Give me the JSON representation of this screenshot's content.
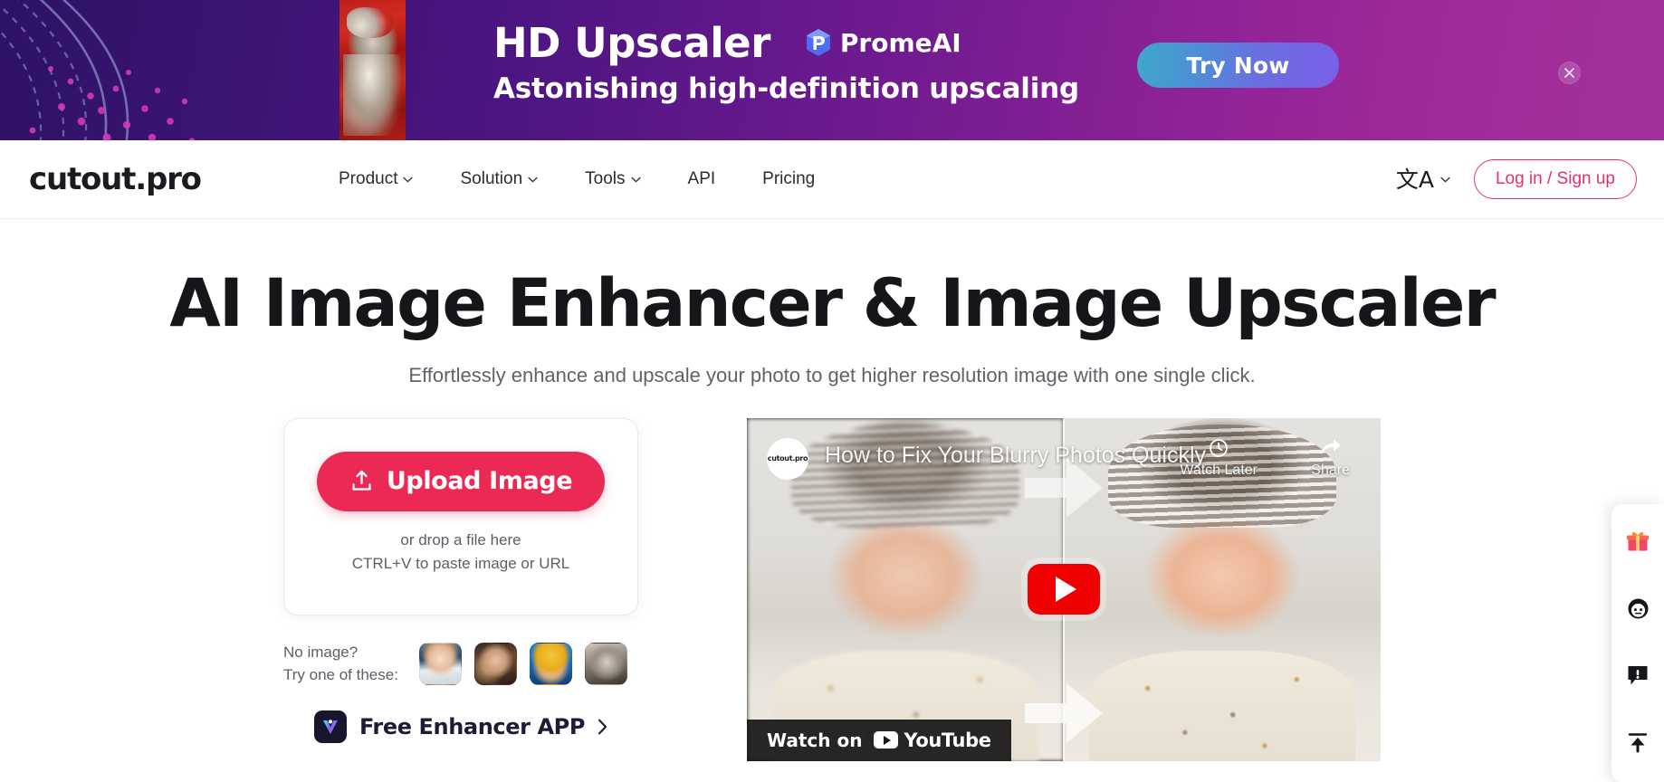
{
  "banner": {
    "title": "HD Upscaler",
    "brand": "PromeAI",
    "subtitle": "Astonishing high-definition upscaling",
    "cta": "Try Now",
    "close_icon": "close-circle-icon",
    "wolf_icon": "wolf-thumbnail",
    "colors": {
      "bg_start": "#2e1266",
      "bg_end": "#a0329c",
      "cta_start": "#3fa8c9",
      "cta_end": "#7b5fe6"
    }
  },
  "navbar": {
    "logo": "cutout.pro",
    "items": [
      {
        "label": "Product",
        "has_caret": true
      },
      {
        "label": "Solution",
        "has_caret": true
      },
      {
        "label": "Tools",
        "has_caret": true
      },
      {
        "label": "API",
        "has_caret": false
      },
      {
        "label": "Pricing",
        "has_caret": false
      }
    ],
    "language_glyph": "文A",
    "language_icon": "translate-icon",
    "login_label": "Log in / Sign up",
    "accent": "#e5306a"
  },
  "hero": {
    "title": "AI Image Enhancer & Image Upscaler",
    "subtitle": "Effortlessly enhance and upscale your photo to get higher resolution image with one single click."
  },
  "upload": {
    "button_label": "Upload Image",
    "upload_icon": "upload-icon",
    "drop_line_1": "or drop a file here",
    "drop_line_2": "CTRL+V to paste image or URL",
    "button_color": "#ea2a55"
  },
  "samples": {
    "label_line_1": "No image?",
    "label_line_2": "Try one of these:",
    "thumbnails": [
      {
        "name": "sample-thumbnail-girl"
      },
      {
        "name": "sample-thumbnail-woman"
      },
      {
        "name": "sample-thumbnail-anime"
      },
      {
        "name": "sample-thumbnail-vintage"
      }
    ]
  },
  "app_link": {
    "label": "Free Enhancer APP",
    "icon": "enhancer-app-icon",
    "chevron": "chevron-right-icon"
  },
  "video": {
    "channel_badge": "cutout.pro",
    "title": "How to Fix Your Blurry Photos Quickly",
    "watch_later_label": "Watch Later",
    "watch_later_icon": "clock-icon",
    "share_label": "Share",
    "share_icon": "share-arrow-icon",
    "play_icon": "youtube-play-icon",
    "watch_on_label": "Watch on",
    "youtube_label": "YouTube"
  },
  "side_rail": {
    "items": [
      {
        "name": "gift-icon"
      },
      {
        "name": "avatar-support-icon"
      },
      {
        "name": "feedback-icon"
      },
      {
        "name": "back-to-top-icon"
      }
    ]
  }
}
